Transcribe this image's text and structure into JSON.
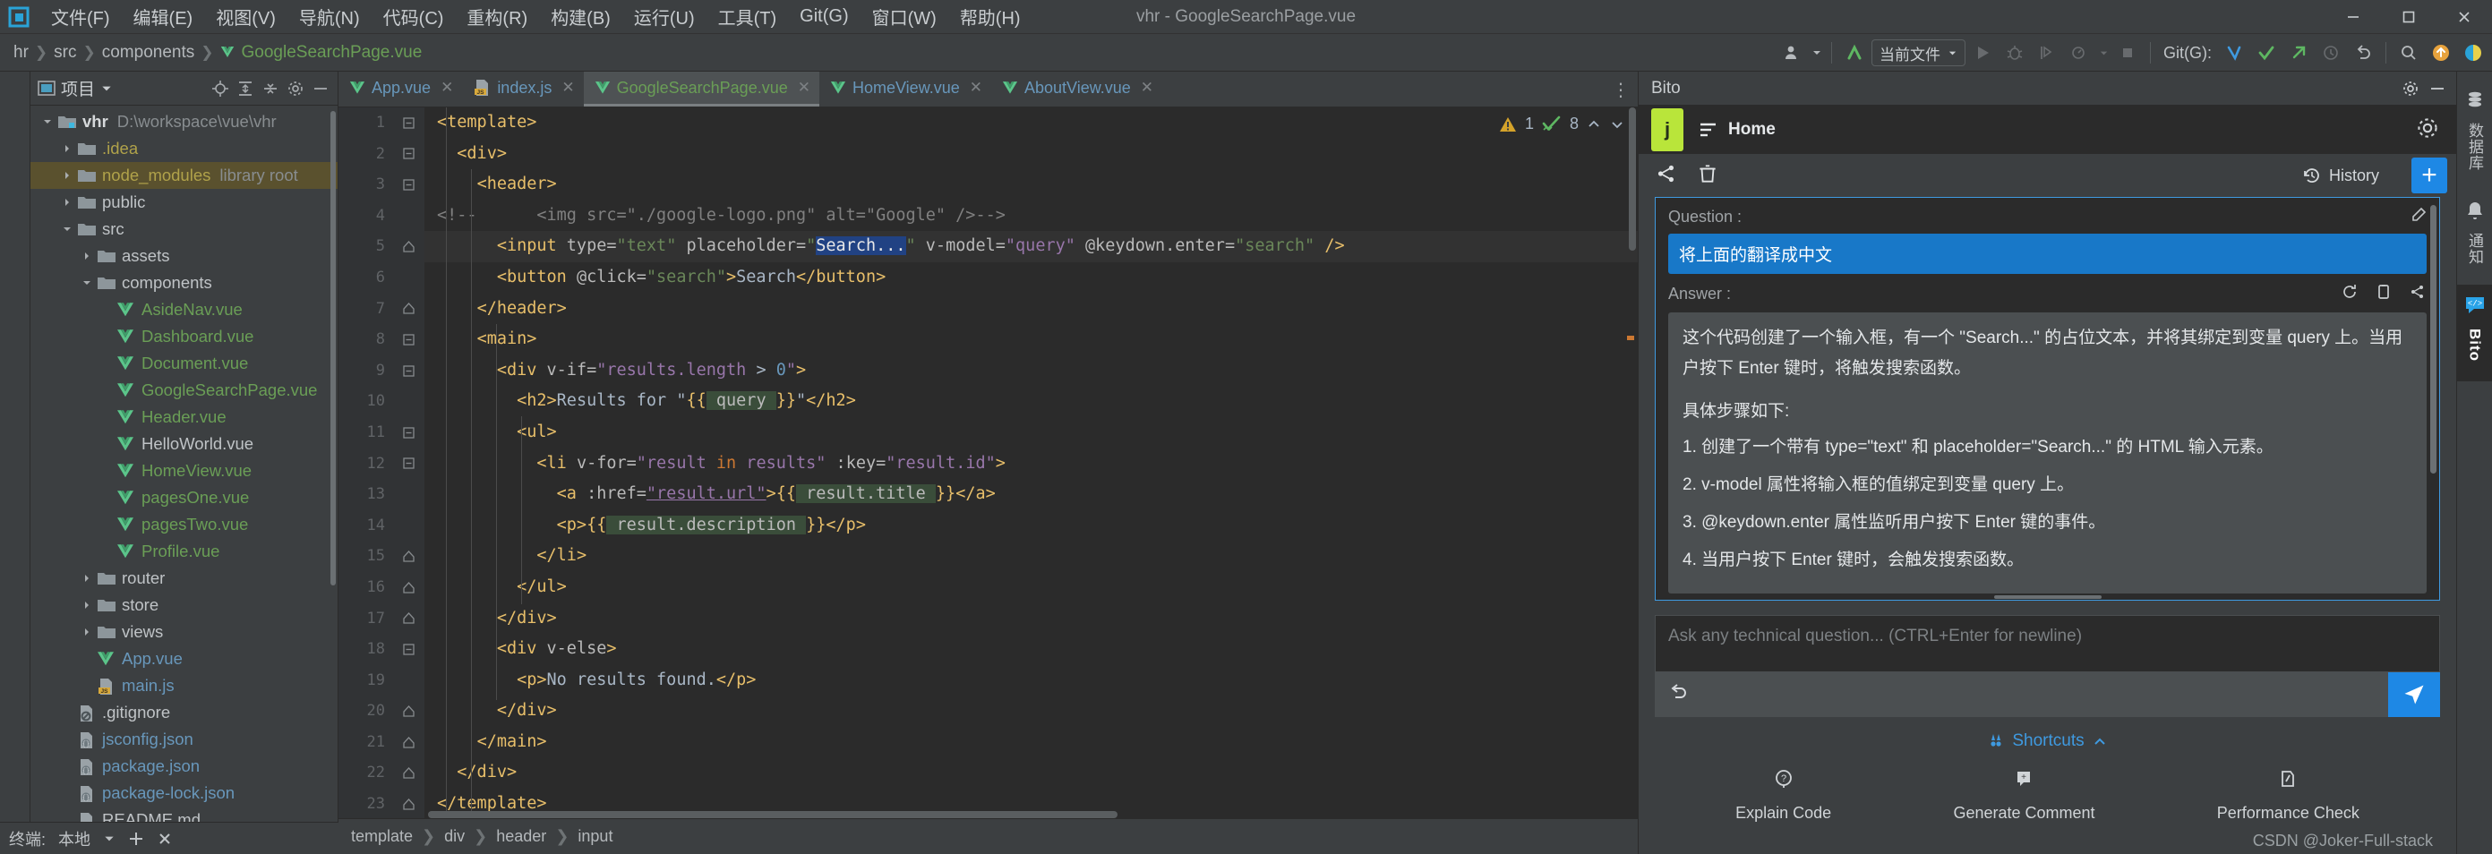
{
  "window": {
    "title": "vhr - GoogleSearchPage.vue",
    "controls": [
      "minimize",
      "maximize",
      "close"
    ]
  },
  "menubar": {
    "items": [
      {
        "label": "文件(F)"
      },
      {
        "label": "编辑(E)"
      },
      {
        "label": "视图(V)"
      },
      {
        "label": "导航(N)"
      },
      {
        "label": "代码(C)"
      },
      {
        "label": "重构(R)"
      },
      {
        "label": "构建(B)"
      },
      {
        "label": "运行(U)"
      },
      {
        "label": "工具(T)"
      },
      {
        "label": "Git(G)"
      },
      {
        "label": "窗口(W)"
      },
      {
        "label": "帮助(H)"
      }
    ]
  },
  "navbar": {
    "breadcrumbs": [
      "hr",
      "src",
      "components",
      "GoogleSearchPage.vue"
    ],
    "run_config": "当前文件",
    "git_label": "Git(G):"
  },
  "project_panel": {
    "title": "项目",
    "tree": [
      {
        "depth": 0,
        "arrow": "down",
        "icon": "module-folder",
        "label": "vhr",
        "style": "bold",
        "suffix": "D:\\workspace\\vue\\vhr"
      },
      {
        "depth": 1,
        "arrow": "right",
        "icon": "folder",
        "label": ".idea",
        "style": "yellow"
      },
      {
        "depth": 1,
        "arrow": "right",
        "icon": "folder",
        "label": "node_modules",
        "style": "yellow",
        "suffix": "library root",
        "selected": true
      },
      {
        "depth": 1,
        "arrow": "right",
        "icon": "folder",
        "label": "public",
        "style": "plain"
      },
      {
        "depth": 1,
        "arrow": "down",
        "icon": "folder",
        "label": "src",
        "style": "plain"
      },
      {
        "depth": 2,
        "arrow": "right",
        "icon": "folder",
        "label": "assets",
        "style": "plain"
      },
      {
        "depth": 2,
        "arrow": "down",
        "icon": "folder",
        "label": "components",
        "style": "plain"
      },
      {
        "depth": 3,
        "arrow": "none",
        "icon": "vue",
        "label": "AsideNav.vue",
        "style": "green"
      },
      {
        "depth": 3,
        "arrow": "none",
        "icon": "vue",
        "label": "Dashboard.vue",
        "style": "green"
      },
      {
        "depth": 3,
        "arrow": "none",
        "icon": "vue",
        "label": "Document.vue",
        "style": "green"
      },
      {
        "depth": 3,
        "arrow": "none",
        "icon": "vue",
        "label": "GoogleSearchPage.vue",
        "style": "green"
      },
      {
        "depth": 3,
        "arrow": "none",
        "icon": "vue",
        "label": "Header.vue",
        "style": "green"
      },
      {
        "depth": 3,
        "arrow": "none",
        "icon": "vue",
        "label": "HelloWorld.vue",
        "style": "plain"
      },
      {
        "depth": 3,
        "arrow": "none",
        "icon": "vue",
        "label": "HomeView.vue",
        "style": "green"
      },
      {
        "depth": 3,
        "arrow": "none",
        "icon": "vue",
        "label": "pagesOne.vue",
        "style": "green"
      },
      {
        "depth": 3,
        "arrow": "none",
        "icon": "vue",
        "label": "pagesTwo.vue",
        "style": "green"
      },
      {
        "depth": 3,
        "arrow": "none",
        "icon": "vue",
        "label": "Profile.vue",
        "style": "green"
      },
      {
        "depth": 2,
        "arrow": "right",
        "icon": "folder",
        "label": "router",
        "style": "plain"
      },
      {
        "depth": 2,
        "arrow": "right",
        "icon": "folder",
        "label": "store",
        "style": "plain"
      },
      {
        "depth": 2,
        "arrow": "right",
        "icon": "folder",
        "label": "views",
        "style": "plain"
      },
      {
        "depth": 2,
        "arrow": "none",
        "icon": "vue",
        "label": "App.vue",
        "style": "blue"
      },
      {
        "depth": 2,
        "arrow": "none",
        "icon": "js",
        "label": "main.js",
        "style": "blue"
      },
      {
        "depth": 1,
        "arrow": "none",
        "icon": "gitignore",
        "label": ".gitignore",
        "style": "plain"
      },
      {
        "depth": 1,
        "arrow": "none",
        "icon": "json",
        "label": "jsconfig.json",
        "style": "blue"
      },
      {
        "depth": 1,
        "arrow": "none",
        "icon": "json",
        "label": "package.json",
        "style": "blue"
      },
      {
        "depth": 1,
        "arrow": "none",
        "icon": "json",
        "label": "package-lock.json",
        "style": "blue"
      },
      {
        "depth": 1,
        "arrow": "none",
        "icon": "md",
        "label": "README.md",
        "style": "plain"
      }
    ]
  },
  "status_bar": {
    "terminal_label": "终端:",
    "local_label": "本地"
  },
  "editor": {
    "tabs": [
      {
        "label": "App.vue",
        "icon": "vue",
        "color": "blue",
        "active": false
      },
      {
        "label": "index.js",
        "icon": "js",
        "color": "blue",
        "active": false
      },
      {
        "label": "GoogleSearchPage.vue",
        "icon": "vue",
        "color": "green",
        "active": true
      },
      {
        "label": "HomeView.vue",
        "icon": "vue",
        "color": "blue",
        "active": false
      },
      {
        "label": "AboutView.vue",
        "icon": "vue",
        "color": "blue",
        "active": false
      }
    ],
    "inspection": {
      "warnings": "1",
      "checks": "8"
    },
    "breadcrumb": [
      "template",
      "div",
      "header",
      "input"
    ],
    "lines": [
      {
        "n": 1,
        "fold": "start-top",
        "tokens": [
          {
            "t": "tag",
            "v": "<template>"
          }
        ]
      },
      {
        "n": 2,
        "fold": "start",
        "tokens": [
          {
            "t": "txt",
            "v": "  "
          },
          {
            "t": "tag",
            "v": "<div>"
          }
        ]
      },
      {
        "n": 3,
        "fold": "start",
        "tokens": [
          {
            "t": "txt",
            "v": "    "
          },
          {
            "t": "tag",
            "v": "<header>"
          }
        ]
      },
      {
        "n": 4,
        "fold": "none",
        "tokens": [
          {
            "t": "cmt",
            "v": "<!--      <img src=\"./google-logo.png\" alt=\"Google\" />-->"
          }
        ],
        "comment": true
      },
      {
        "n": 5,
        "fold": "bulb",
        "highlight": true,
        "tokens": [
          {
            "t": "txt",
            "v": "      "
          },
          {
            "t": "tag",
            "v": "<input "
          },
          {
            "t": "attr",
            "v": "type="
          },
          {
            "t": "str",
            "v": "\"text\""
          },
          {
            "t": "attr",
            "v": " placeholder="
          },
          {
            "t": "str",
            "v": "\""
          },
          {
            "t": "selblue",
            "v": "Search..."
          },
          {
            "t": "str",
            "v": "\""
          },
          {
            "t": "attr",
            "v": " v-model="
          },
          {
            "t": "vue",
            "v": "\"query\""
          },
          {
            "t": "attr",
            "v": " @keydown.enter="
          },
          {
            "t": "str",
            "v": "\"search\""
          },
          {
            "t": "tag",
            "v": " />"
          }
        ]
      },
      {
        "n": 6,
        "fold": "none",
        "tokens": [
          {
            "t": "txt",
            "v": "      "
          },
          {
            "t": "tag",
            "v": "<button "
          },
          {
            "t": "attr",
            "v": "@click="
          },
          {
            "t": "str",
            "v": "\"search\""
          },
          {
            "t": "tag",
            "v": ">"
          },
          {
            "t": "txt",
            "v": "Search"
          },
          {
            "t": "tag",
            "v": "</button>"
          }
        ]
      },
      {
        "n": 7,
        "fold": "end",
        "tokens": [
          {
            "t": "txt",
            "v": "    "
          },
          {
            "t": "tag",
            "v": "</header>"
          }
        ]
      },
      {
        "n": 8,
        "fold": "start",
        "tokens": [
          {
            "t": "txt",
            "v": "    "
          },
          {
            "t": "tag",
            "v": "<main>"
          }
        ]
      },
      {
        "n": 9,
        "fold": "start",
        "tokens": [
          {
            "t": "txt",
            "v": "      "
          },
          {
            "t": "tag",
            "v": "<div "
          },
          {
            "t": "attr",
            "v": "v-if="
          },
          {
            "t": "vue",
            "v": "\"results.length "
          },
          {
            "t": "txt",
            "v": "> "
          },
          {
            "t": "num",
            "v": "0"
          },
          {
            "t": "vue",
            "v": "\""
          },
          {
            "t": "tag",
            "v": ">"
          }
        ]
      },
      {
        "n": 10,
        "fold": "none",
        "tokens": [
          {
            "t": "txt",
            "v": "        "
          },
          {
            "t": "tag",
            "v": "<h2>"
          },
          {
            "t": "txt",
            "v": "Results for \""
          },
          {
            "t": "tag",
            "v": "{{"
          },
          {
            "t": "selgreen",
            "v": " query "
          },
          {
            "t": "tag",
            "v": "}}"
          },
          {
            "t": "txt",
            "v": "\""
          },
          {
            "t": "tag",
            "v": "</h2>"
          }
        ]
      },
      {
        "n": 11,
        "fold": "start",
        "tokens": [
          {
            "t": "txt",
            "v": "        "
          },
          {
            "t": "tag",
            "v": "<ul>"
          }
        ]
      },
      {
        "n": 12,
        "fold": "start",
        "tokens": [
          {
            "t": "txt",
            "v": "          "
          },
          {
            "t": "tag",
            "v": "<li "
          },
          {
            "t": "attr",
            "v": "v-for="
          },
          {
            "t": "vue",
            "v": "\"result "
          },
          {
            "t": "kw",
            "v": "in"
          },
          {
            "t": "vue",
            "v": " results\""
          },
          {
            "t": "attr",
            "v": " :key="
          },
          {
            "t": "vue",
            "v": "\"result.id\""
          },
          {
            "t": "tag",
            "v": ">"
          }
        ]
      },
      {
        "n": 13,
        "fold": "none",
        "tokens": [
          {
            "t": "txt",
            "v": "            "
          },
          {
            "t": "tag",
            "v": "<a "
          },
          {
            "t": "attr",
            "v": ":href="
          },
          {
            "t": "vueu",
            "v": "\"result.url\""
          },
          {
            "t": "tag",
            "v": ">{{"
          },
          {
            "t": "selgreen",
            "v": " result.title "
          },
          {
            "t": "tag",
            "v": "}}</a>"
          }
        ]
      },
      {
        "n": 14,
        "fold": "none",
        "tokens": [
          {
            "t": "txt",
            "v": "            "
          },
          {
            "t": "tag",
            "v": "<p>{{"
          },
          {
            "t": "selgreen",
            "v": " result.description "
          },
          {
            "t": "tag",
            "v": "}}</p>"
          }
        ]
      },
      {
        "n": 15,
        "fold": "end",
        "tokens": [
          {
            "t": "txt",
            "v": "          "
          },
          {
            "t": "tag",
            "v": "</li>"
          }
        ]
      },
      {
        "n": 16,
        "fold": "end",
        "tokens": [
          {
            "t": "txt",
            "v": "        "
          },
          {
            "t": "tag",
            "v": "</ul>"
          }
        ]
      },
      {
        "n": 17,
        "fold": "end",
        "tokens": [
          {
            "t": "txt",
            "v": "      "
          },
          {
            "t": "tag",
            "v": "</div>"
          }
        ]
      },
      {
        "n": 18,
        "fold": "start",
        "tokens": [
          {
            "t": "txt",
            "v": "      "
          },
          {
            "t": "tag",
            "v": "<div "
          },
          {
            "t": "attr",
            "v": "v-else"
          },
          {
            "t": "tag",
            "v": ">"
          }
        ]
      },
      {
        "n": 19,
        "fold": "none",
        "tokens": [
          {
            "t": "txt",
            "v": "        "
          },
          {
            "t": "tag",
            "v": "<p>"
          },
          {
            "t": "txt",
            "v": "No results found."
          },
          {
            "t": "tag",
            "v": "</p>"
          }
        ]
      },
      {
        "n": 20,
        "fold": "end",
        "tokens": [
          {
            "t": "txt",
            "v": "      "
          },
          {
            "t": "tag",
            "v": "</div>"
          }
        ]
      },
      {
        "n": 21,
        "fold": "end",
        "tokens": [
          {
            "t": "txt",
            "v": "    "
          },
          {
            "t": "tag",
            "v": "</main>"
          }
        ]
      },
      {
        "n": 22,
        "fold": "end",
        "tokens": [
          {
            "t": "txt",
            "v": "  "
          },
          {
            "t": "tag",
            "v": "</div>"
          }
        ]
      },
      {
        "n": 23,
        "fold": "end-bottom",
        "tokens": [
          {
            "t": "tag",
            "v": "</template>"
          }
        ]
      }
    ]
  },
  "bito": {
    "panel_title": "Bito",
    "avatar_letter": "j",
    "home_tab": "Home",
    "history_label": "History",
    "question_label": "Question :",
    "question_text": "将上面的翻译成中文",
    "answer_label": "Answer :",
    "answer_paragraph": "这个代码创建了一个输入框，有一个 \"Search...\" 的占位文本，并将其绑定到变量 query 上。当用户按下 Enter 键时，将触发搜索函数。",
    "answer_steps_title": "具体步骤如下:",
    "answer_steps": [
      "1. 创建了一个带有 type=\"text\" 和 placeholder=\"Search...\" 的 HTML 输入元素。",
      "2. v-model 属性将输入框的值绑定到变量 query 上。",
      "3. @keydown.enter 属性监听用户按下 Enter 键的事件。",
      "4. 当用户按下 Enter 键时，会触发搜索函数。"
    ],
    "ask_placeholder": "Ask any technical question... (CTRL+Enter for newline)",
    "shortcuts_label": "Shortcuts",
    "shortcuts": [
      {
        "label": "Explain Code",
        "icon": "question-circle-icon"
      },
      {
        "label": "Generate Comment",
        "icon": "comment-icon"
      },
      {
        "label": "Performance Check",
        "icon": "gauge-icon"
      }
    ],
    "watermark": "CSDN @Joker-Full-stack"
  },
  "right_strip": {
    "items": [
      {
        "label": "数据库",
        "icon": "database-icon",
        "active": false
      },
      {
        "label": "通知",
        "icon": "bell-icon",
        "active": false
      },
      {
        "label": "Bito",
        "icon": "bito-icon",
        "active": true
      }
    ]
  },
  "colors": {
    "accent_blue": "#1e88e5",
    "bito_green": "#b9e53a",
    "vue_green": "#6a9e56",
    "selection_blue": "#214283",
    "tree_selected": "#5a512e"
  }
}
